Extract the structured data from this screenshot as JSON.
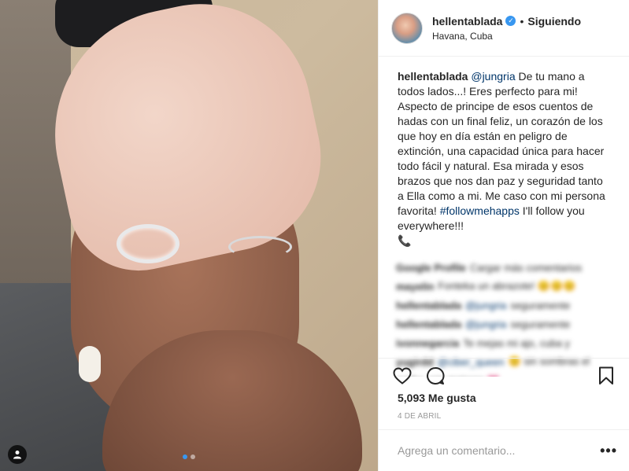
{
  "post": {
    "username": "hellentablada",
    "verified": true,
    "separator": "•",
    "follow_status": "Siguiendo",
    "location": "Havana, Cuba"
  },
  "caption": {
    "username": "hellentablada",
    "mention": "@jungria",
    "text1": " De tu mano a todos lados...! Eres perfecto para mi! Aspecto de principe de esos cuentos de hadas con un final feliz, un corazón de los que hoy en día están en peligro de extinción, una capacidad única para hacer todo fácil y natural. Esa mirada y esos brazos que nos dan paz y seguridad tanto a Ella como a mi. Me caso con mi persona favorita! ",
    "hashtag": "#followmehapps",
    "text2": " I'll follow you everywhere!!!",
    "phone_emoji": "📞"
  },
  "blurred_comments": [
    {
      "user": "Google Profile",
      "text": "Cargar más comentarios"
    },
    {
      "user": "mayelin",
      "text": "Fonteka un abrazote! 😊😊😊"
    },
    {
      "user": "hellentablada",
      "mention": "@jungria",
      "text": "seguramente"
    },
    {
      "user": "hellentablada",
      "mention": "@jungria",
      "text": "seguramente"
    },
    {
      "user": "ivonnegarcia",
      "text": "Te mejas mi ajo, cuba y"
    },
    {
      "user": "yugirdd",
      "mention": "@ciber_queen",
      "text": "😊 sin sombras el"
    },
    {
      "user": "",
      "text": "amiko, mis mejores 💗"
    }
  ],
  "stats": {
    "likes": "5,093 Me gusta",
    "date": "4 DE ABRIL"
  },
  "comment_box": {
    "placeholder": "Agrega un comentario...",
    "more": "•••"
  },
  "icons": {
    "heart": "heart-icon",
    "comment": "comment-icon",
    "bookmark": "bookmark-icon",
    "tag": "user-tag-icon"
  },
  "colors": {
    "link": "#003569",
    "verified": "#3897f0",
    "muted": "#999999"
  }
}
